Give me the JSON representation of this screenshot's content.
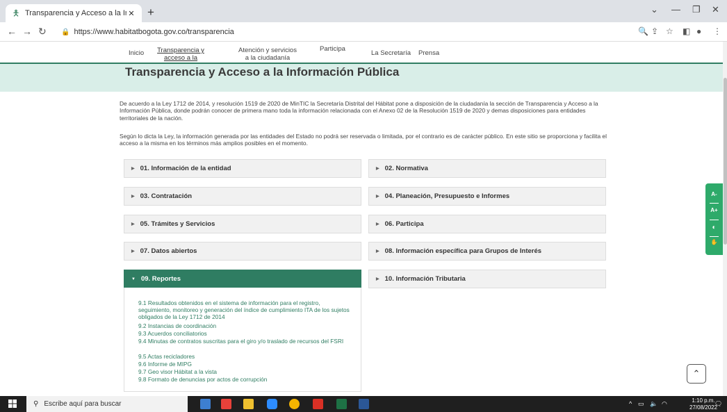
{
  "browser": {
    "tab_title": "Transparencia y Acceso a la Inform",
    "url": "https://www.habitatbogota.gov.co/transparencia"
  },
  "nav": {
    "items": [
      "Inicio",
      "Transparencia y acceso a la información pública",
      "Atención y servicios a la ciudadanía",
      "Participa",
      "La Secretaría",
      "Prensa"
    ]
  },
  "page": {
    "heading": "Transparencia y Acceso a la Información Pública",
    "para1": "De acuerdo a la Ley 1712 de 2014, y resolución 1519 de 2020 de MinTIC la Secretaría Distrital del Hábitat pone a disposición de la ciudadanía la sección de Transparencia y Acceso a la Información Pública, donde podrán conocer de primera mano toda la información relacionada con el Anexo 02 de la Resolución 1519 de 2020 y demas disposiciones para entidades territoriales de la nación.",
    "para2": "Según lo dicta la Ley, la información generada por las entidades del Estado no podrá ser reservada o limitada, por el contrario es de carácter público. En este sitio se proporciona y facilita el acceso a la misma en los términos más amplios posibles en el momento."
  },
  "sections": [
    "01. Información de la entidad",
    "02. Normativa",
    "03. Contratación",
    "04. Planeación, Presupuesto e Informes",
    "05. Trámites y Servicios",
    "06. Participa",
    "07. Datos abiertos",
    "08. Información específica para Grupos de Interés",
    "09. Reportes",
    "10. Información Tributaria"
  ],
  "reportes_links": [
    "9.1 Resultados obtenidos en el sistema de información para el registro, seguimiento, monitoreo y generación del índice de cumplimiento ITA de los sujetos obligados de la Ley 1712 de 2014",
    "9.2 Instancias de coordinación",
    "9.3 Acuerdos conciliatorios",
    "9.4 Minutas de contratos suscritas para el giro y/o traslado de recursos del FSRI",
    "9.5 Actas recicladores",
    "9.6 Informe de MIPG",
    "9.7 Geo visor Hábitat a la vista",
    "9.8 Formato de denuncias por actos de corrupción"
  ],
  "accessibility": {
    "decrease": "A-",
    "increase": "A+"
  },
  "taskbar": {
    "search_placeholder": "Escribe aquí para buscar",
    "time": "1:10 p.m.",
    "date": "27/08/2022"
  }
}
